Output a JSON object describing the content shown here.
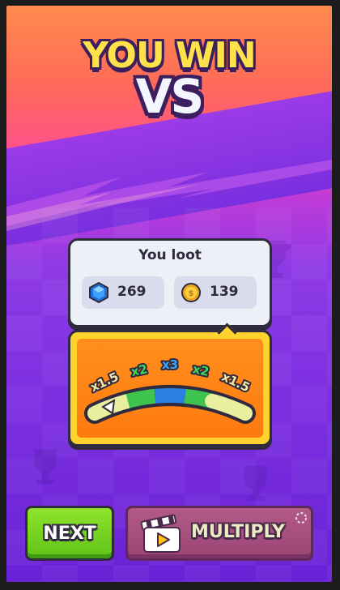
{
  "title": {
    "line1": "YOU WIN",
    "line2": "VS"
  },
  "loot": {
    "heading": "You loot",
    "gems": {
      "icon": "blue-gem-icon",
      "value": "269"
    },
    "coins": {
      "icon": "gold-coin-icon",
      "value": "139"
    }
  },
  "multiplier": {
    "labels": [
      "x1.5",
      "x2",
      "x3",
      "x2",
      "x1.5"
    ],
    "segment_colors": [
      "#e8f0a0",
      "#3fc34f",
      "#2a7fe0",
      "#3fc34f",
      "#e8f0a0"
    ]
  },
  "buttons": {
    "next": "NEXT",
    "multiply": "MULTIPLY",
    "multiply_icon": "clapperboard-play-icon"
  },
  "colors": {
    "accent_yellow": "#ffd22e",
    "next_green": "#6ccf1e",
    "multiply_pink": "#a84f80",
    "outline": "#2f2a3d"
  }
}
